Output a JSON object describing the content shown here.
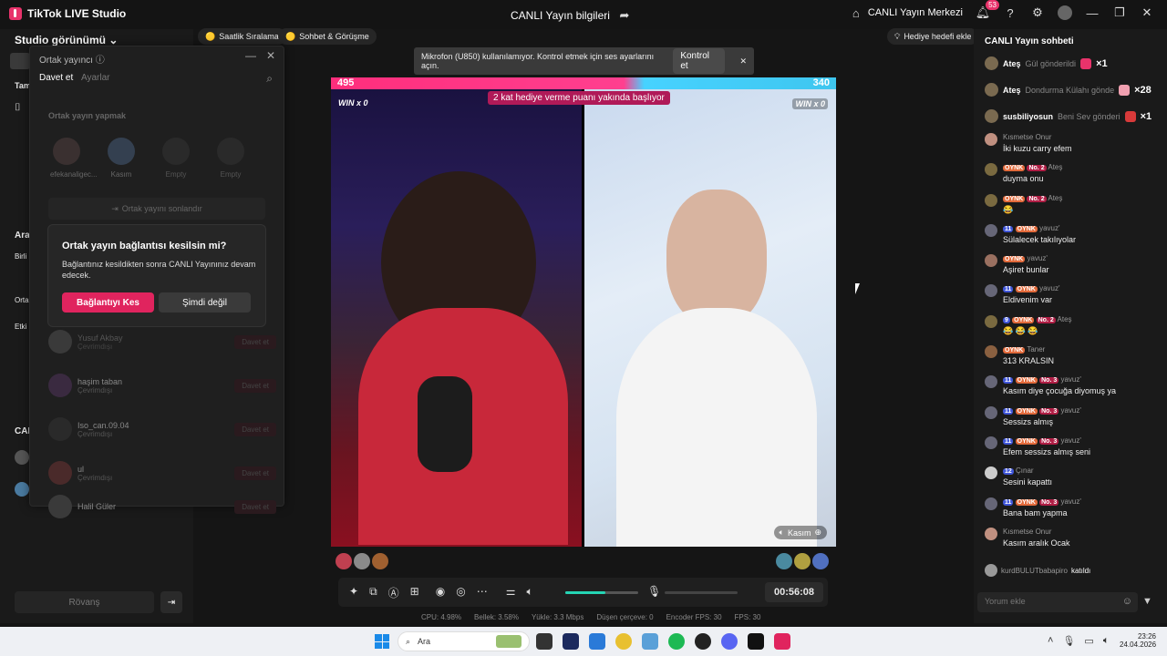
{
  "titlebar": {
    "app_name": "TikTok LIVE Studio",
    "center": "CANLI Yayın bilgileri",
    "live_center": "CANLI Yayın Merkezi",
    "notif_count": "53"
  },
  "left": {
    "studio_label": "Studio görünümü",
    "trunc": [
      "Tam",
      "Ara",
      "Birli",
      "Orta",
      "Etki",
      "CAN"
    ],
    "rematch": "Rövanş"
  },
  "pills": [
    "Saatlik Sıralama",
    "Sohbet & Görüşme"
  ],
  "popup": {
    "title": "Ortak yayıncı",
    "tab_invite": "Davet et",
    "tab_settings": "Ayarlar",
    "section": "Ortak yayın yapmak",
    "slots": [
      "efekanaligec...",
      "Kasım",
      "Empty",
      "Empty"
    ],
    "end_btn": "Ortak yayını sonlandır",
    "list": [
      {
        "name": "Yusuf Akbay",
        "status": "Çevrimdışı",
        "btn": "Davet et"
      },
      {
        "name": "haşim taban",
        "status": "Çevrimdışı",
        "btn": "Davet et"
      },
      {
        "name": "Iso_can.09.04",
        "status": "Çevrimdışı",
        "btn": "Davet et"
      },
      {
        "name": "ul",
        "status": "Çevrimdışı",
        "btn": "Davet et"
      },
      {
        "name": "Halil Güler",
        "status": "",
        "btn": "Davet et"
      }
    ]
  },
  "dialog": {
    "title": "Ortak yayın bağlantısı kesilsin mi?",
    "body": "Bağlantınız kesildikten sonra CANLI Yayınınız devam edecek.",
    "confirm": "Bağlantıyı Kes",
    "cancel": "Şimdi değil"
  },
  "toast": {
    "text": "Mikrofon (U850) kullanılamıyor. Kontrol etmek için ses ayarlarını açın.",
    "action": "Kontrol et"
  },
  "gift_goal": "Hediye hedefi ekle",
  "battle": {
    "left_score": "495",
    "right_score": "340",
    "banner": "2 kat hediye verme puanı yakında başlıyor",
    "left_win": "WIN x 0",
    "right_win": "WIN x 0",
    "right_name": "Kasım"
  },
  "controls": {
    "timer": "00:56:08",
    "volume_fraction": 0.55
  },
  "stats": [
    "CPU: 4.98%",
    "Bellek: 3.58%",
    "Yükle: 3.3 Mbps",
    "Düşen çerçeve: 0",
    "Encoder FPS: 30",
    "FPS: 30"
  ],
  "chat": {
    "title": "CANLI Yayın sohbeti",
    "gifts": [
      {
        "user": "Ateş",
        "text": "Gül gönderildi",
        "count": "×1"
      },
      {
        "user": "Ateş",
        "text": "Dondurma Külahı gönde",
        "count": "×28"
      },
      {
        "user": "susbiliyosun",
        "text": "Beni Sev gönderi",
        "count": "×1"
      }
    ],
    "messages": [
      {
        "tags": [],
        "user": "Kısmetse Onur",
        "text": "İki kuzu carry efem"
      },
      {
        "tags": [
          "OYNK",
          "No. 2"
        ],
        "user": "Ateş",
        "text": "duyma onu"
      },
      {
        "tags": [
          "OYNK",
          "No. 2"
        ],
        "user": "Ateş",
        "text": "😂"
      },
      {
        "tags": [
          "11",
          "OYNK"
        ],
        "user": "yavuz'",
        "text": "Sülalecek takılıyolar"
      },
      {
        "tags": [
          "OYNK"
        ],
        "user": "yavuz'",
        "text": "Aşiret bunlar"
      },
      {
        "tags": [
          "11",
          "OYNK"
        ],
        "user": "yavuz'",
        "text": "Eldivenim var"
      },
      {
        "tags": [
          "9",
          "OYNK",
          "No. 2"
        ],
        "user": "Ateş",
        "text": "😂 😂 😂"
      },
      {
        "tags": [
          "OYNK"
        ],
        "user": "Taner",
        "text": "313 KRALSIN"
      },
      {
        "tags": [
          "11",
          "OYNK",
          "No. 3"
        ],
        "user": "yavuz'",
        "text": "Kasım diye çocuğa diyomuş ya"
      },
      {
        "tags": [
          "11",
          "OYNK",
          "No. 3"
        ],
        "user": "yavuz'",
        "text": "Sessizs almış"
      },
      {
        "tags": [
          "11",
          "OYNK",
          "No. 3"
        ],
        "user": "yavuz'",
        "text": "Efem sessizs almış seni"
      },
      {
        "tags": [
          "12"
        ],
        "user": "Çınar",
        "text": "Sesini kapattı"
      },
      {
        "tags": [
          "11",
          "OYNK",
          "No. 3"
        ],
        "user": "yavuz'",
        "text": "Bana bam yapma"
      },
      {
        "tags": [],
        "user": "Kısmetse Onur",
        "text": "Kasım aralık Ocak"
      }
    ],
    "joined_user": "kurdBULUTbabapiro",
    "joined_text": "katıldı",
    "input_placeholder": "Yorum ekle"
  },
  "taskbar": {
    "search": "Ara",
    "time": "23:26",
    "date": "24.04.2026"
  }
}
